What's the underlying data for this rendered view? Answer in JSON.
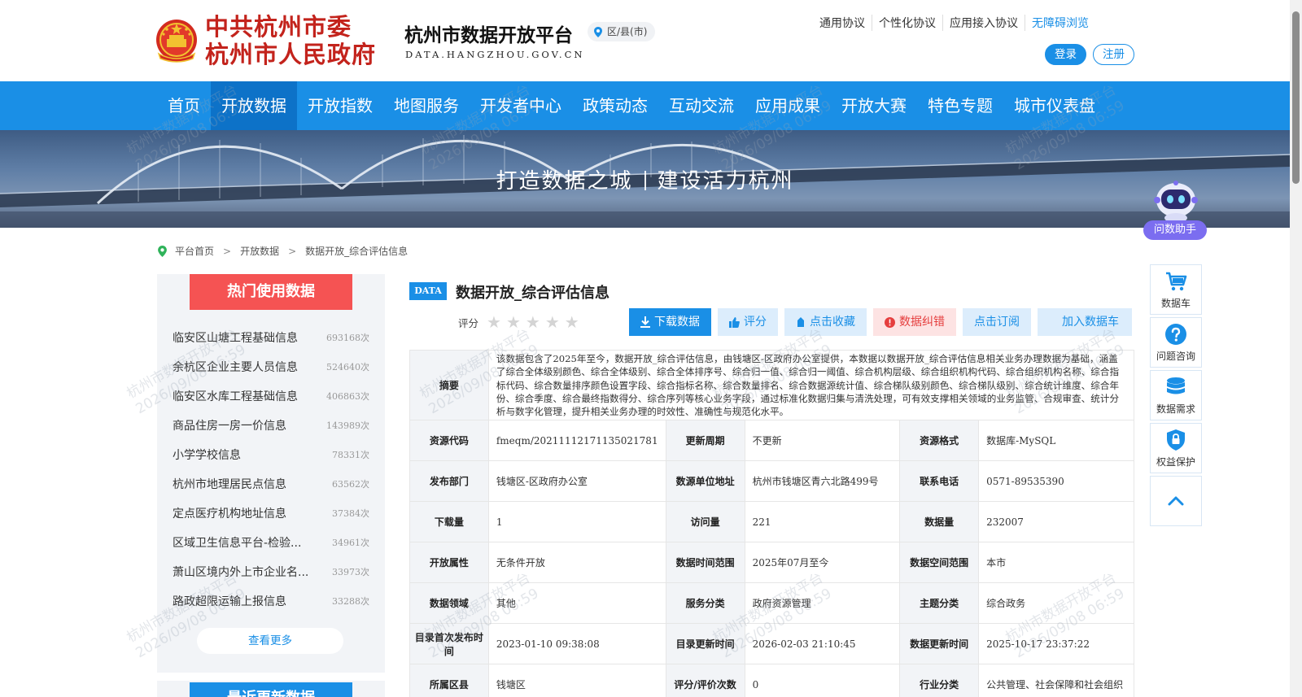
{
  "header": {
    "gov_line1": "中共杭州市委",
    "gov_line2": "杭州市人民政府",
    "platform_title": "杭州市数据开放平台",
    "platform_domain": "DATA.HANGZHOU.GOV.CN",
    "region_selector": "区/县(市)",
    "top_links": [
      "通用协议",
      "个性化协议",
      "应用接入协议",
      "无障碍浏览"
    ],
    "login_label": "登录",
    "register_label": "注册"
  },
  "nav": {
    "items": [
      "首页",
      "开放数据",
      "开放指数",
      "地图服务",
      "开发者中心",
      "政策动态",
      "互动交流",
      "应用成果",
      "开放大赛",
      "特色专题",
      "城市仪表盘"
    ],
    "active": "开放数据"
  },
  "banner": {
    "slogan_left": "打造数据之城",
    "slogan_right": "建设活力杭州"
  },
  "assistant": {
    "label": "问数助手"
  },
  "breadcrumb": [
    "平台首页",
    "开放数据",
    "数据开放_综合评估信息"
  ],
  "hot_panel": {
    "title": "热门使用数据",
    "items": [
      {
        "name": "临安区山塘工程基础信息",
        "count": "693168次"
      },
      {
        "name": "余杭区企业主要人员信息",
        "count": "524640次"
      },
      {
        "name": "临安区水库工程基础信息",
        "count": "406863次"
      },
      {
        "name": "商品住房一房一价信息",
        "count": "143989次"
      },
      {
        "name": "小学学校信息",
        "count": "78331次"
      },
      {
        "name": "杭州市地理居民点信息",
        "count": "63562次"
      },
      {
        "name": "定点医疗机构地址信息",
        "count": "37384次"
      },
      {
        "name": "区域卫生信息平台-检验...",
        "count": "34961次"
      },
      {
        "name": "萧山区境内外上市企业名...",
        "count": "33973次"
      },
      {
        "name": "路政超限运输上报信息",
        "count": "33288次"
      }
    ],
    "more_label": "查看更多"
  },
  "second_panel": {
    "title": "最近更新数据"
  },
  "dataset": {
    "badge": "DATA",
    "title": "数据开放_综合评估信息",
    "rating_label": "评分",
    "rating_stars": 0,
    "actions": {
      "download": "下载数据",
      "rate": "评分",
      "favorite": "点击收藏",
      "report": "数据纠错",
      "subscribe": "点击订阅",
      "add_cart": "加入数据车"
    },
    "abstract_label": "摘要",
    "abstract": "该数据包含了2025年至今，数据开放_综合评估信息，由钱塘区-区政府办公室提供，本数据以数据开放_综合评估信息相关业务办理数据为基础，涵盖了综合全体级别颜色、综合全体级别、综合全体排序号、综合归一值、综合归一阈值、综合机构层级、综合组织机构代码、综合组织机构名称、综合指标代码、综合数量排序颜色设置字段、综合指标名称、综合数量排名、综合数据源统计值、综合梯队级别颜色、综合梯队级别、综合统计维度、综合年份、综合季度、综合最终指数得分、综合序列等核心业务字段，通过标准化数据归集与清洗处理，可有效支撑相关领域的业务监管、合规审查、统计分析与数字化管理，提升相关业务办理的时效性、准确性与规范化水平。",
    "rows": [
      [
        {
          "k": "资源代码",
          "v": "fmeqm/20211112171135021781"
        },
        {
          "k": "更新周期",
          "v": "不更新"
        },
        {
          "k": "资源格式",
          "v": "数据库-MySQL"
        }
      ],
      [
        {
          "k": "发布部门",
          "v": "钱塘区-区政府办公室"
        },
        {
          "k": "数源单位地址",
          "v": "杭州市钱塘区青六北路499号"
        },
        {
          "k": "联系电话",
          "v": "0571-89535390"
        }
      ],
      [
        {
          "k": "下载量",
          "v": "1"
        },
        {
          "k": "访问量",
          "v": "221"
        },
        {
          "k": "数据量",
          "v": "232007"
        }
      ],
      [
        {
          "k": "开放属性",
          "v": "无条件开放"
        },
        {
          "k": "数据时间范围",
          "v": "2025年07月至今"
        },
        {
          "k": "数据空间范围",
          "v": "本市"
        }
      ],
      [
        {
          "k": "数据领域",
          "v": "其他"
        },
        {
          "k": "服务分类",
          "v": "政府资源管理"
        },
        {
          "k": "主题分类",
          "v": "综合政务"
        }
      ],
      [
        {
          "k": "目录首次发布时间",
          "v": "2023-01-10 09:38:08"
        },
        {
          "k": "目录更新时间",
          "v": "2026-02-03 21:10:45"
        },
        {
          "k": "数据更新时间",
          "v": "2025-10-17 23:37:22"
        }
      ],
      [
        {
          "k": "所属区县",
          "v": "钱塘区"
        },
        {
          "k": "评分/评价次数",
          "v": "0"
        },
        {
          "k": "行业分类",
          "v": "公共管理、社会保障和社会组织"
        }
      ]
    ]
  },
  "tools": [
    {
      "label": "数据车",
      "icon": "cart-icon"
    },
    {
      "label": "问题咨询",
      "icon": "question-icon"
    },
    {
      "label": "数据需求",
      "icon": "database-icon"
    },
    {
      "label": "权益保护",
      "icon": "shield-lock-icon"
    },
    {
      "label": "",
      "icon": "back-to-top-icon"
    }
  ],
  "watermark": {
    "line1": "杭州市数据开放平台",
    "line2": "2026/09/08 06:59"
  },
  "colors": {
    "primary": "#1a8fe6",
    "nav_active": "#0d72c8",
    "hot_title": "#f55353",
    "gov_red": "#c3231c",
    "assistant": "#7b6df0"
  }
}
